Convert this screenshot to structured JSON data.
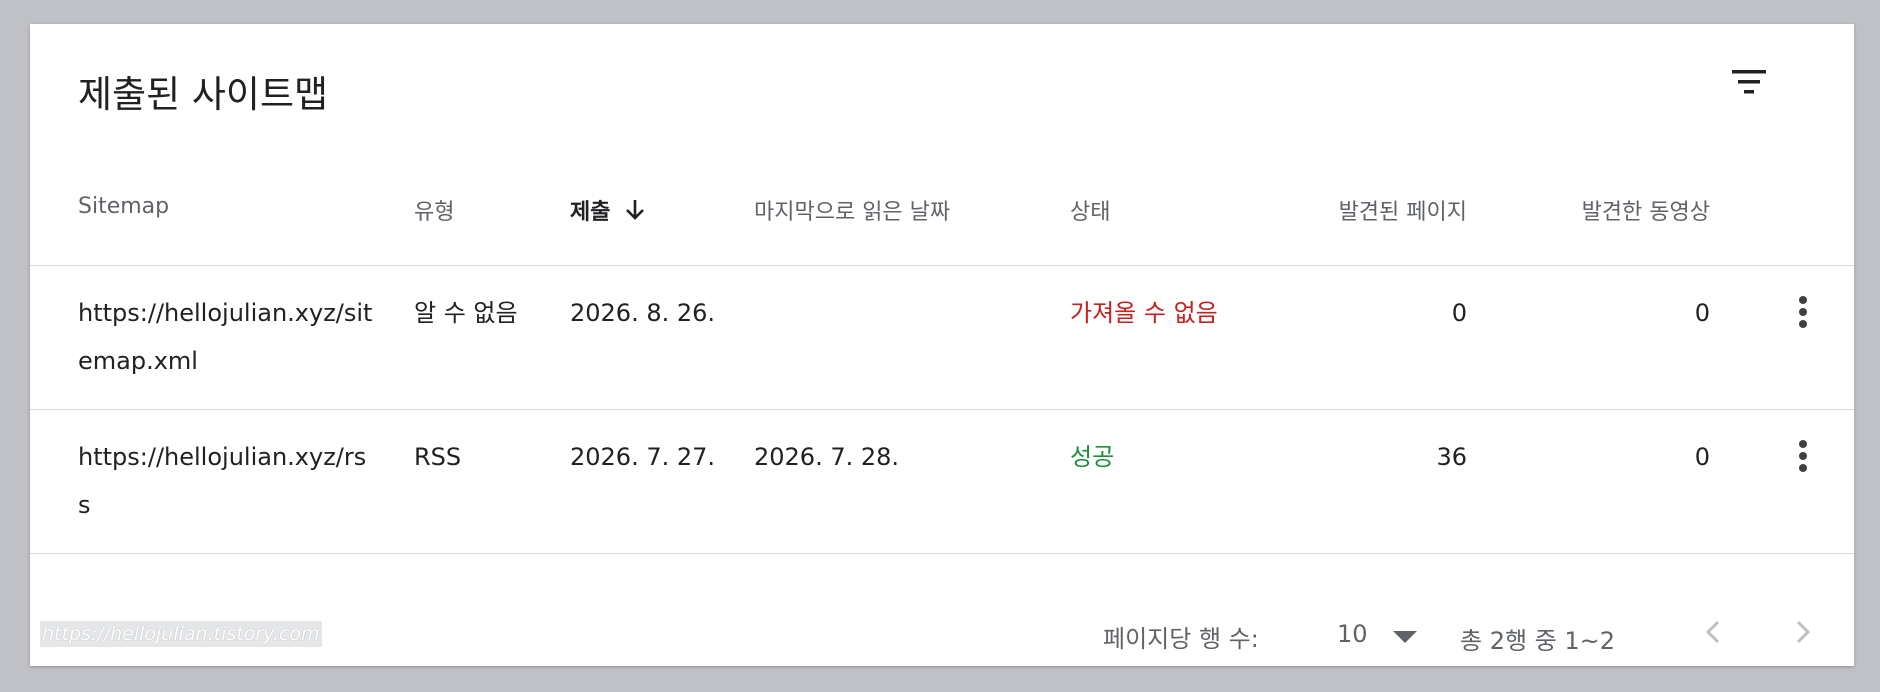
{
  "title": "제출된 사이트맵",
  "toolbar": {
    "filter_icon": "filter-icon"
  },
  "columns": {
    "sitemap": "Sitemap",
    "type": "유형",
    "submitted": "제출",
    "last_read": "마지막으로 읽은 날짜",
    "status": "상태",
    "discovered_pages": "발견된 페이지",
    "discovered_videos": "발견한 동영상"
  },
  "sort": {
    "column": "submitted",
    "direction": "descending",
    "icon": "arrow-down-icon"
  },
  "rows": [
    {
      "sitemap": "https://hellojulian.xyz/sitemap.xml",
      "type": "알 수 없음",
      "submitted": "2026. 8. 26.",
      "last_read": "",
      "status": "가져올 수 없음",
      "status_color": "#c5221f",
      "discovered_pages": "0",
      "discovered_videos": "0"
    },
    {
      "sitemap": "https://hellojulian.xyz/rss",
      "type": "RSS",
      "submitted": "2026. 7. 27.",
      "last_read": "2026. 7. 28.",
      "status": "성공",
      "status_color": "#1e8e3e",
      "discovered_pages": "36",
      "discovered_videos": "0"
    }
  ],
  "footer": {
    "rows_per_page_label": "페이지당 행 수:",
    "rows_per_page_value": "10",
    "range": "총 2행 중 1~2"
  },
  "watermark": "https://hellojulian.tistory.com"
}
